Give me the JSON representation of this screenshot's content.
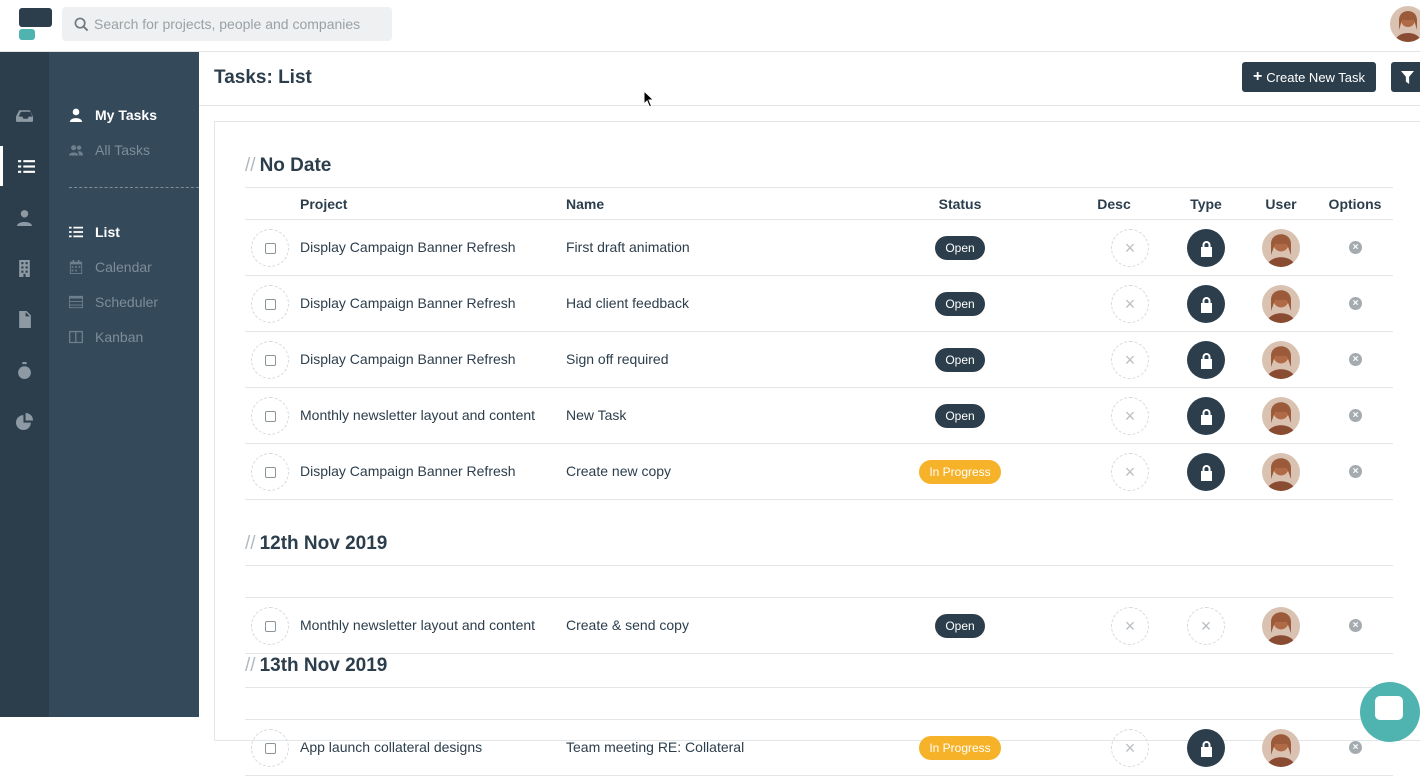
{
  "search": {
    "placeholder": "Search for projects, people and companies"
  },
  "header": {
    "title": "Tasks: List",
    "create_label": "Create New Task"
  },
  "subnav": {
    "groups": [
      {
        "label": "My Tasks",
        "icon": "user-icon"
      },
      {
        "label": "All Tasks",
        "icon": "users-icon"
      }
    ],
    "views": [
      {
        "label": "List",
        "icon": "list-icon"
      },
      {
        "label": "Calendar",
        "icon": "calendar-icon"
      },
      {
        "label": "Scheduler",
        "icon": "scheduler-icon"
      },
      {
        "label": "Kanban",
        "icon": "kanban-icon"
      }
    ]
  },
  "columns": [
    "Project",
    "Name",
    "Status",
    "Desc",
    "Type",
    "User",
    "Options"
  ],
  "sections": [
    {
      "title": "No Date",
      "rows": [
        {
          "project": "Display Campaign Banner Refresh",
          "name": "First draft animation",
          "status": "Open",
          "type": "lock"
        },
        {
          "project": "Display Campaign Banner Refresh",
          "name": "Had client feedback",
          "status": "Open",
          "type": "lock"
        },
        {
          "project": "Display Campaign Banner Refresh",
          "name": "Sign off required",
          "status": "Open",
          "type": "lock"
        },
        {
          "project": "Monthly newsletter layout and content",
          "name": "New Task",
          "status": "Open",
          "type": "lock"
        },
        {
          "project": "Display Campaign Banner Refresh",
          "name": "Create new copy",
          "status": "In Progress",
          "type": "lock"
        }
      ]
    },
    {
      "title": "12th Nov 2019",
      "rows": [
        {
          "project": "Monthly newsletter layout and content",
          "name": "Create & send copy",
          "status": "Open",
          "type": "none"
        }
      ]
    },
    {
      "title": "13th Nov 2019",
      "rows": [
        {
          "project": "App launch collateral designs",
          "name": "Team meeting RE: Collateral",
          "status": "In Progress",
          "type": "lock"
        }
      ]
    }
  ],
  "colors": {
    "navy": "#2c3e4c",
    "sidebar": "#34495a",
    "progress": "#f6b228",
    "teal": "#4fb3b0"
  }
}
